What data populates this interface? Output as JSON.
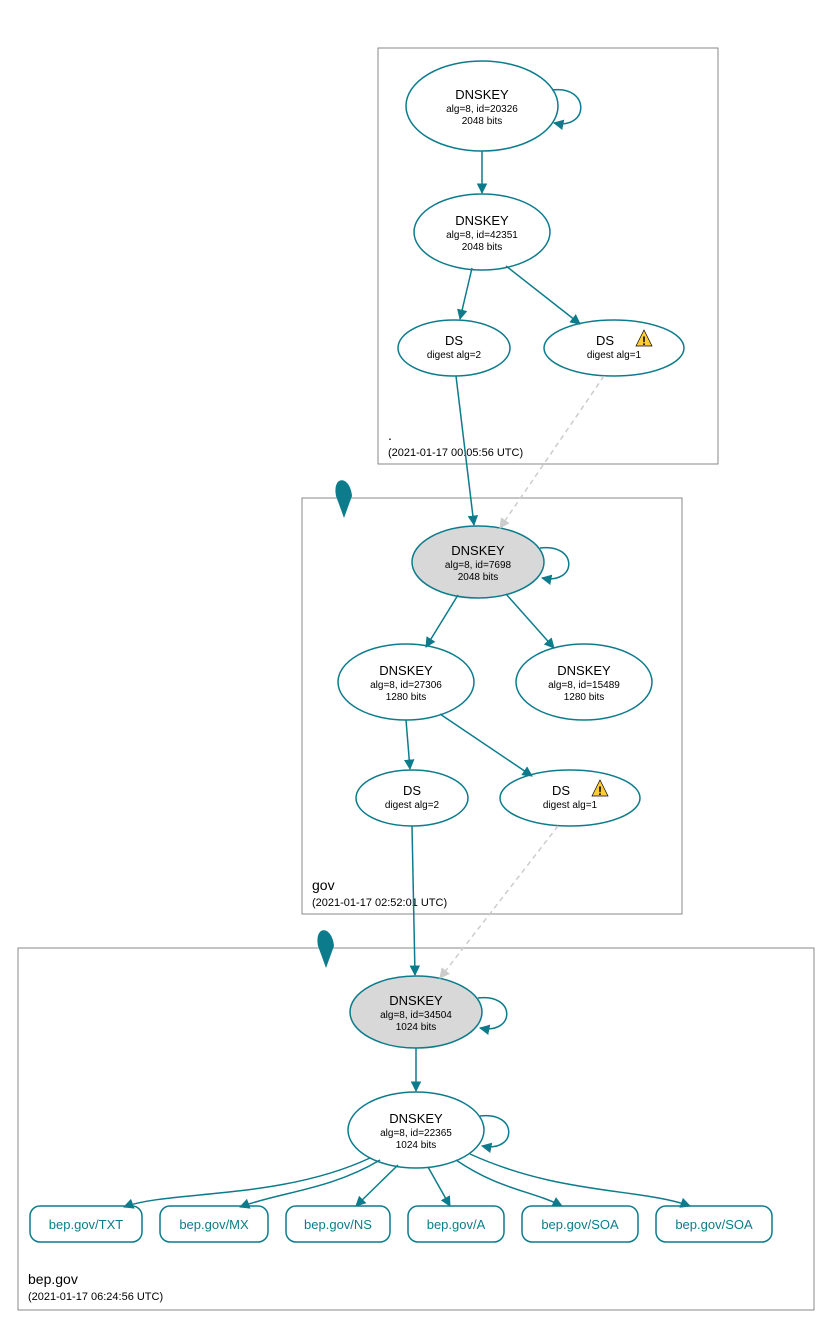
{
  "zones": {
    "root": {
      "label": ".",
      "timestamp": "(2021-01-17 00:05:56 UTC)"
    },
    "gov": {
      "label": "gov",
      "timestamp": "(2021-01-17 02:52:01 UTC)"
    },
    "bep": {
      "label": "bep.gov",
      "timestamp": "(2021-01-17 06:24:56 UTC)"
    }
  },
  "nodes": {
    "root_ksk": {
      "title": "DNSKEY",
      "line1": "alg=8, id=20326",
      "line2": "2048 bits"
    },
    "root_zsk": {
      "title": "DNSKEY",
      "line1": "alg=8, id=42351",
      "line2": "2048 bits"
    },
    "root_ds2": {
      "title": "DS",
      "line1": "digest alg=2"
    },
    "root_ds1": {
      "title": "DS",
      "line1": "digest alg=1"
    },
    "gov_ksk": {
      "title": "DNSKEY",
      "line1": "alg=8, id=7698",
      "line2": "2048 bits"
    },
    "gov_zsk1": {
      "title": "DNSKEY",
      "line1": "alg=8, id=27306",
      "line2": "1280 bits"
    },
    "gov_zsk2": {
      "title": "DNSKEY",
      "line1": "alg=8, id=15489",
      "line2": "1280 bits"
    },
    "gov_ds2": {
      "title": "DS",
      "line1": "digest alg=2"
    },
    "gov_ds1": {
      "title": "DS",
      "line1": "digest alg=1"
    },
    "bep_ksk": {
      "title": "DNSKEY",
      "line1": "alg=8, id=34504",
      "line2": "1024 bits"
    },
    "bep_zsk": {
      "title": "DNSKEY",
      "line1": "alg=8, id=22365",
      "line2": "1024 bits"
    }
  },
  "records": {
    "r0": "bep.gov/TXT",
    "r1": "bep.gov/MX",
    "r2": "bep.gov/NS",
    "r3": "bep.gov/A",
    "r4": "bep.gov/SOA",
    "r5": "bep.gov/SOA"
  }
}
